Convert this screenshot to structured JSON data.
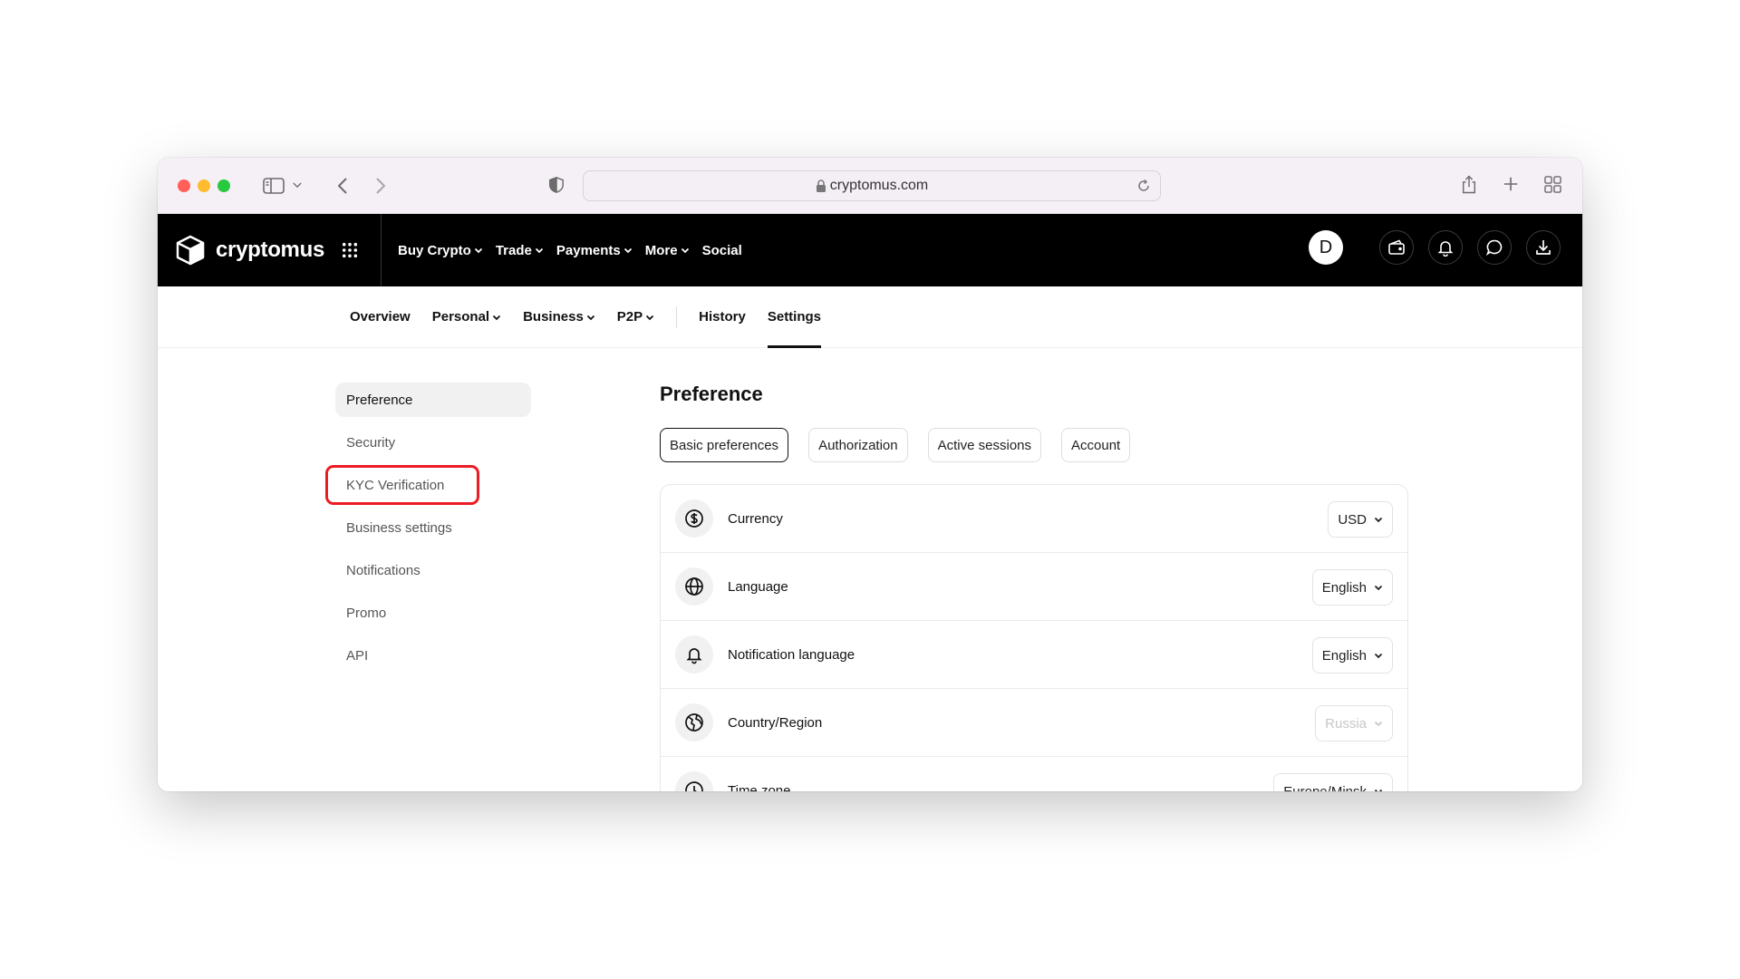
{
  "browser": {
    "url": "cryptomus.com"
  },
  "header": {
    "logo_text": "cryptomus",
    "nav": [
      {
        "label": "Buy Crypto",
        "has_menu": true
      },
      {
        "label": "Trade",
        "has_menu": true
      },
      {
        "label": "Payments",
        "has_menu": true
      },
      {
        "label": "More",
        "has_menu": true
      },
      {
        "label": "Social",
        "has_menu": false
      }
    ],
    "avatar_initial": "D"
  },
  "subnav": {
    "items": [
      {
        "label": "Overview"
      },
      {
        "label": "Personal"
      },
      {
        "label": "Business"
      },
      {
        "label": "P2P"
      },
      {
        "label": "History"
      },
      {
        "label": "Settings"
      }
    ]
  },
  "sidebar": {
    "items": [
      {
        "label": "Preference"
      },
      {
        "label": "Security"
      },
      {
        "label": "KYC Verification"
      },
      {
        "label": "Business settings"
      },
      {
        "label": "Notifications"
      },
      {
        "label": "Promo"
      },
      {
        "label": "API"
      }
    ]
  },
  "panel": {
    "title": "Preference",
    "tabs": [
      {
        "label": "Basic preferences"
      },
      {
        "label": "Authorization"
      },
      {
        "label": "Active sessions"
      },
      {
        "label": "Account"
      }
    ],
    "rows": [
      {
        "label": "Currency",
        "value": "USD",
        "icon": "dollar-icon"
      },
      {
        "label": "Language",
        "value": "English",
        "icon": "globe-icon"
      },
      {
        "label": "Notification language",
        "value": "English",
        "icon": "bell-icon"
      },
      {
        "label": "Country/Region",
        "value": "Russia",
        "icon": "country-icon"
      },
      {
        "label": "Time zone",
        "value": "Europe/Minsk",
        "icon": "clock-icon"
      }
    ]
  },
  "colors": {
    "highlight": "#ec1c24",
    "header_bg": "#000000",
    "toolbar_bg": "#f5eff6"
  }
}
